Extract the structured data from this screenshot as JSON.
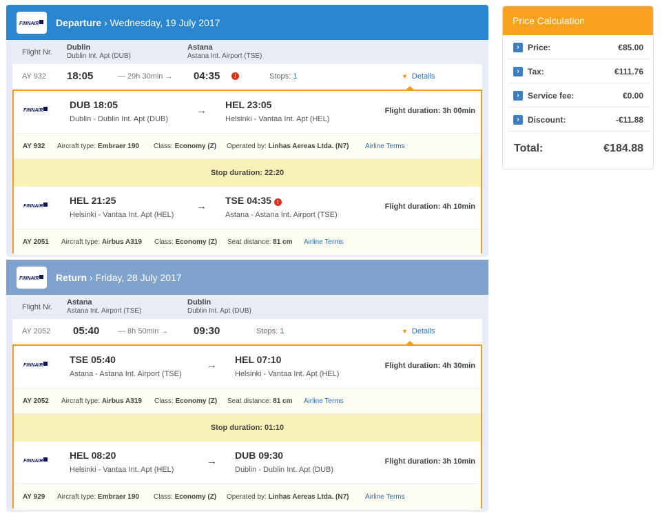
{
  "departure": {
    "direction": "Departure",
    "date": "Wednesday, 19 July 2017",
    "flight_nr_label": "Flight Nr.",
    "origin_city": "Dublin",
    "origin_airport": "Dublin Int. Apt (DUB)",
    "dest_city": "Astana",
    "dest_airport": "Astana Int. Airport (TSE)",
    "summary": {
      "flight_no": "AY 932",
      "dep_time": "18:05",
      "duration": "— 29h 30min →",
      "arr_time": "04:35",
      "stops_label": "Stops:",
      "stops": "1",
      "details": "Details"
    },
    "segments": [
      {
        "dep": "DUB 18:05",
        "dep_airport": "Dublin - Dublin Int. Apt (DUB)",
        "arr": "HEL 23:05",
        "arr_airport": "Helsinki - Vantaa Int. Apt (HEL)",
        "duration": "Flight duration: 3h 00min",
        "flight_no": "AY 932",
        "aircraft_label": "Aircraft type:",
        "aircraft": "Embraer 190",
        "class_label": "Class:",
        "class": "Economy (Z)",
        "extra_label": "Operated by:",
        "extra": "Linhas Aereas Ltda. (N7)",
        "terms": "Airline Terms"
      },
      {
        "dep": "HEL 21:25",
        "dep_airport": "Helsinki - Vantaa Int. Apt (HEL)",
        "arr": "TSE 04:35",
        "arr_airport": "Astana - Astana Int. Airport (TSE)",
        "duration": "Flight duration: 4h 10min",
        "flight_no": "AY 2051",
        "aircraft_label": "Aircraft type:",
        "aircraft": "Airbus A319",
        "class_label": "Class:",
        "class": "Economy (Z)",
        "extra_label": "Seat distance:",
        "extra": "81 cm",
        "terms": "Airline Terms"
      }
    ],
    "stop": "Stop duration: 22:20"
  },
  "return": {
    "direction": "Return",
    "date": "Friday, 28 July 2017",
    "flight_nr_label": "Flight Nr.",
    "origin_city": "Astana",
    "origin_airport": "Astana Int. Airport (TSE)",
    "dest_city": "Dublin",
    "dest_airport": "Dublin Int. Apt (DUB)",
    "summary": {
      "flight_no": "AY 2052",
      "dep_time": "05:40",
      "duration": "— 8h 50min →",
      "arr_time": "09:30",
      "stops_label": "Stops:",
      "stops": "1",
      "details": "Details"
    },
    "segments": [
      {
        "dep": "TSE 05:40",
        "dep_airport": "Astana - Astana Int. Airport (TSE)",
        "arr": "HEL 07:10",
        "arr_airport": "Helsinki - Vantaa Int. Apt (HEL)",
        "duration": "Flight duration: 4h 30min",
        "flight_no": "AY 2052",
        "aircraft_label": "Aircraft type:",
        "aircraft": "Airbus A319",
        "class_label": "Class:",
        "class": "Economy (Z)",
        "extra_label": "Seat distance:",
        "extra": "81 cm",
        "terms": "Airline Terms"
      },
      {
        "dep": "HEL 08:20",
        "dep_airport": "Helsinki - Vantaa Int. Apt (HEL)",
        "arr": "DUB 09:30",
        "arr_airport": "Dublin - Dublin Int. Apt (DUB)",
        "duration": "Flight duration: 3h 10min",
        "flight_no": "AY 929",
        "aircraft_label": "Aircraft type:",
        "aircraft": "Embraer 190",
        "class_label": "Class:",
        "class": "Economy (Z)",
        "extra_label": "Operated by:",
        "extra": "Linhas Aereas Ltda. (N7)",
        "terms": "Airline Terms"
      }
    ],
    "stop": "Stop duration: 01:10"
  },
  "price": {
    "title": "Price Calculation",
    "rows": [
      {
        "label": "Price:",
        "value": "€85.00"
      },
      {
        "label": "Tax:",
        "value": "€111.76"
      },
      {
        "label": "Service fee:",
        "value": "€0.00"
      },
      {
        "label": "Discount:",
        "value": "-€11.88"
      }
    ],
    "total_label": "Total:",
    "total": "€184.88"
  },
  "logo_text": "FINNAIR",
  "icons": {
    "chevron": "chevron-right-icon",
    "alert": "alert-icon",
    "caret": "caret-down-icon"
  },
  "colors": {
    "departure_header": "#2a86cf",
    "return_header": "#7fa3cd",
    "accent": "#f39a1e",
    "link": "#2a6ebb",
    "stop_bg": "#f8f2b8"
  }
}
